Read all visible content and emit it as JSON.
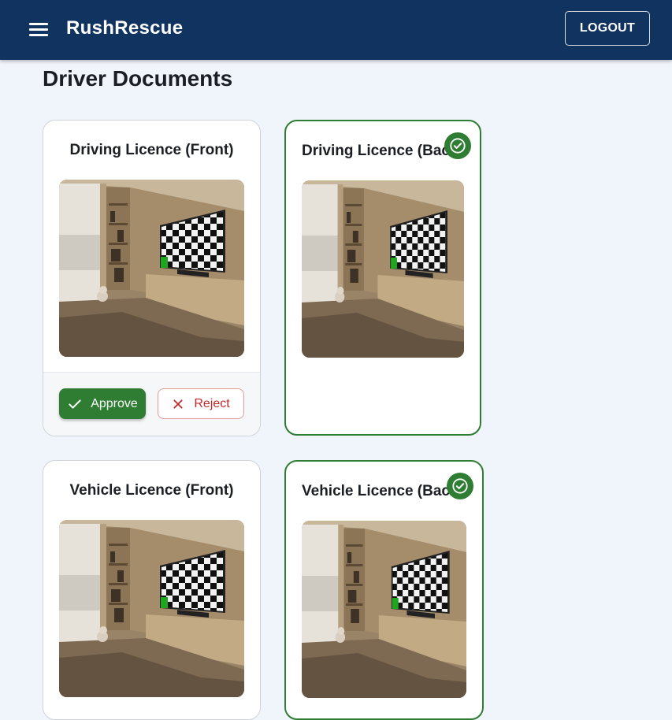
{
  "app": {
    "title": "RushRescue",
    "logout_label": "LOGOUT"
  },
  "page": {
    "title": "Driver Documents"
  },
  "documents": [
    {
      "title": "Driving Licence (Front)",
      "status": "pending",
      "image": "document-photo"
    },
    {
      "title": "Driving Licence (Back)",
      "status": "approved",
      "image": "document-photo"
    },
    {
      "title": "Vehicle Licence (Front)",
      "status": "pending",
      "image": "document-photo"
    },
    {
      "title": "Vehicle Licence (Back)",
      "status": "approved",
      "image": "document-photo"
    }
  ],
  "actions": {
    "approve_label": "Approve",
    "reject_label": "Reject"
  },
  "colors": {
    "appbar": "#11335f",
    "approve": "#2e7d32",
    "reject": "#c62828",
    "background": "#f0f4fb"
  },
  "icons": [
    "menu-icon",
    "check-circle-icon",
    "check-icon",
    "close-icon"
  ]
}
